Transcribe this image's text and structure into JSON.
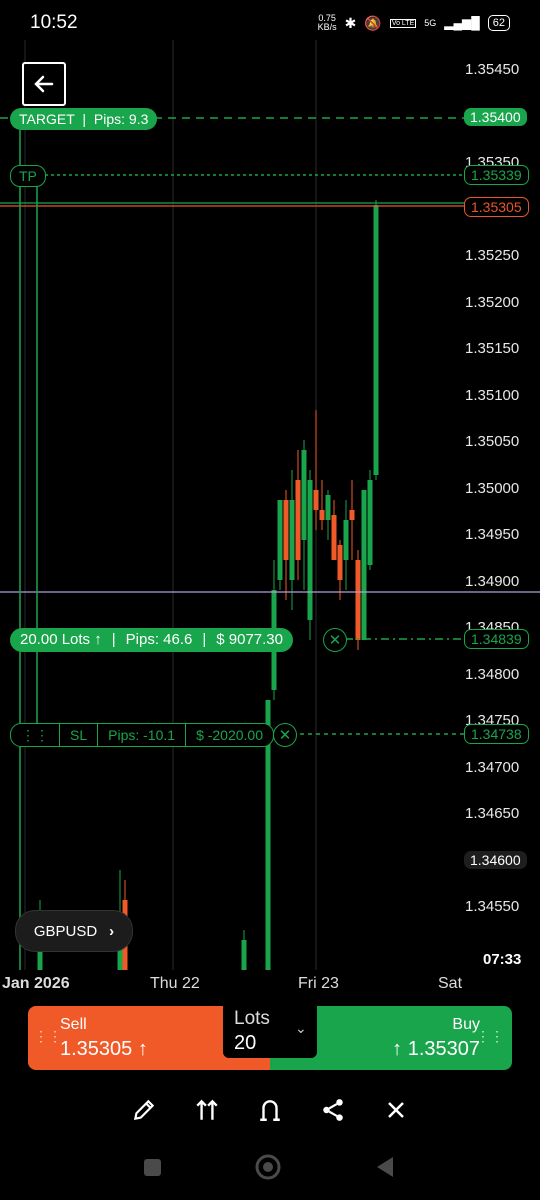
{
  "status_bar": {
    "time": "10:52",
    "net_speed_value": "0.75",
    "net_speed_unit": "KB/s",
    "network": "5G",
    "battery": "62",
    "icons": [
      "bluetooth-icon",
      "mute-icon",
      "volte-icon",
      "signal-icon",
      "battery-icon"
    ]
  },
  "chart": {
    "price_levels": [
      "1.35450",
      "1.35400",
      "1.35350",
      "1.35339",
      "1.35305",
      "1.35250",
      "1.35200",
      "1.35150",
      "1.35100",
      "1.35050",
      "1.35000",
      "1.34950",
      "1.34900",
      "1.34850",
      "1.34839",
      "1.34800",
      "1.34750",
      "1.34738",
      "1.34700",
      "1.34650",
      "1.34600",
      "1.34550"
    ],
    "target_price": "1.35400",
    "tp_price": "1.35339",
    "current_price": "1.35305",
    "entry_price": "1.34839",
    "sl_price": "1.34738",
    "highlight_price": "1.34600",
    "countdown": "07:33",
    "dates": [
      "Jan 2026",
      "Thu 22",
      "Fri 23",
      "Sat"
    ],
    "colors": {
      "bull": "#19a54b",
      "bear": "#f05a28",
      "crosshair": "#b39ddb"
    }
  },
  "target": {
    "label": "TARGET",
    "pips": "Pips: 9.3"
  },
  "tp": {
    "label": "TP"
  },
  "position": {
    "lots": "20.00 Lots",
    "pips": "Pips: 46.6",
    "profit": "$ 9077.30"
  },
  "sl": {
    "label": "SL",
    "pips": "Pips: -10.1",
    "loss": "$ -2020.00"
  },
  "symbol": {
    "name": "GBPUSD"
  },
  "trade": {
    "sell_label": "Sell",
    "sell_price": "1.35305",
    "buy_label": "Buy",
    "buy_price": "1.35307",
    "lots_label": "Lots",
    "lots_value": "20"
  },
  "toolbar": [
    "pencil-icon",
    "indicators-icon",
    "magnet-icon",
    "share-icon",
    "close-icon"
  ]
}
